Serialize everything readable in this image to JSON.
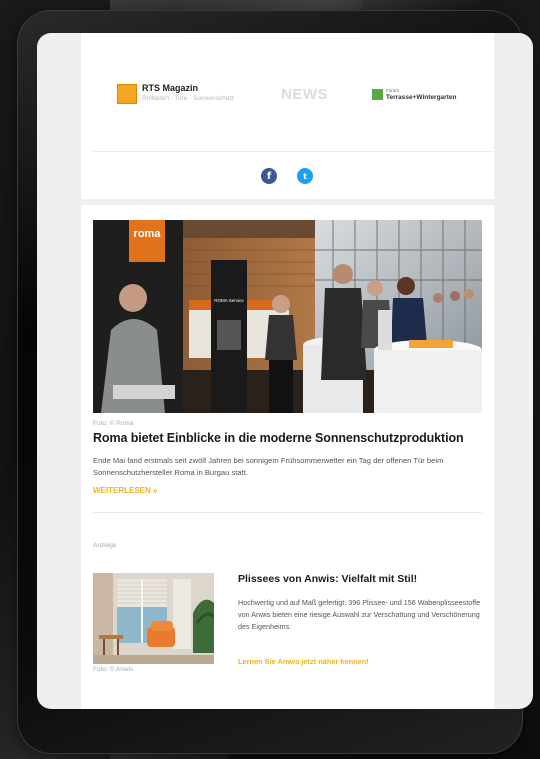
{
  "header": {
    "logo_rts": {
      "title": "RTS Magazin",
      "subtitle": "Rollladen · Tore · Sonnenschutz",
      "color": "#f5a623"
    },
    "logo_news": "NEWS",
    "logo_terrasse": {
      "small": "Forum",
      "big": "Terrasse+Wintergarten",
      "color": "#5aa845"
    },
    "social": {
      "facebook": "f",
      "twitter": "t"
    }
  },
  "article": {
    "photo_credit": "Foto: © Roma",
    "sign_text": "roma",
    "banner_text": "ROMA Service",
    "headline": "Roma bietet Einblicke in die moderne Sonnenschutzproduktion",
    "teaser": "Ende Mai fand erstmals seit zwölf Jahren bei sonnigem Frühsommerwetter ein Tag der offenen Tür beim Sonnenschutzhersteller Roma in Burgau statt.",
    "more_label": "WEITERLESEN »"
  },
  "ad": {
    "label": "Anzeige",
    "photo_credit": "Foto: © Anwis",
    "title": "Plissees von Anwis: Vielfalt mit Stil!",
    "text": "Hochwertig und auf Maß gefertigt: 396 Plissee- und 156 Wabenplisseestoffe von Anwis bieten eine riesige Auswahl zur Verschattung und Verschönerung des Eigenheims.",
    "link_label": "Lernen Sie Anwis jetzt näher kennen!"
  },
  "colors": {
    "accent": "#f2b418",
    "facebook": "#3b5998",
    "twitter": "#1da1f2"
  }
}
